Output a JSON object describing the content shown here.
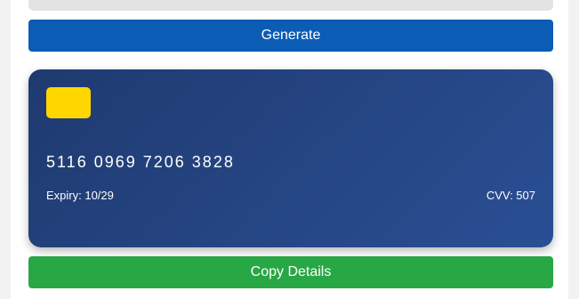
{
  "actions": {
    "generate_label": "Generate",
    "copy_label": "Copy Details"
  },
  "card": {
    "number": "5116 0969 7206 3828",
    "expiry": "Expiry: 10/29",
    "cvv": "CVV: 507"
  },
  "colors": {
    "primary_button": "#0b5cb5",
    "copy_button": "#28a745",
    "card_gradient_start": "#1f3a70",
    "card_gradient_end": "#2a4f94",
    "chip": "#ffd700"
  }
}
